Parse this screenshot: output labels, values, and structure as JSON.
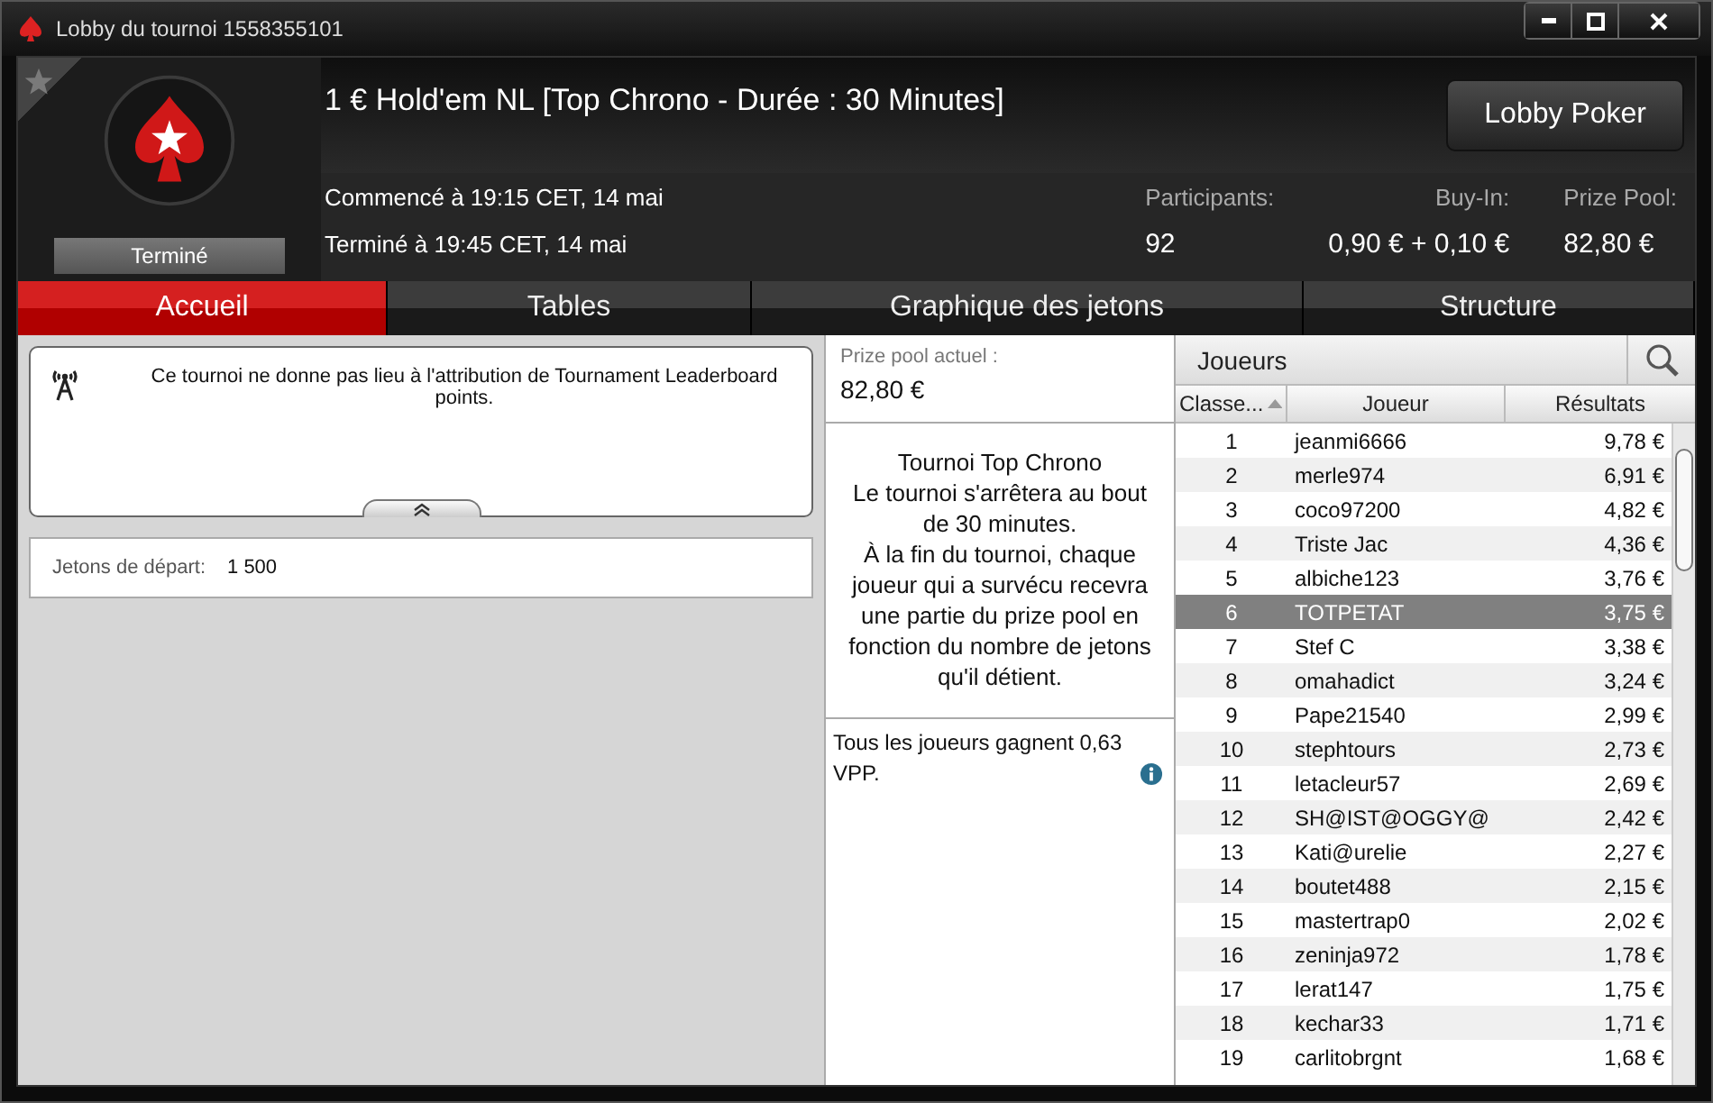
{
  "window": {
    "title": "Lobby du tournoi 1558355101"
  },
  "header": {
    "favorite": false,
    "status": "Terminé",
    "title": "1 € Hold'em NL [Top Chrono - Durée : 30 Minutes]",
    "started": "Commencé à 19:15 CET, 14 mai",
    "ended": "Terminé à 19:45 CET, 14 mai",
    "lobby_button": "Lobby Poker",
    "stats": [
      {
        "label": "Participants:",
        "value": "92"
      },
      {
        "label": "Buy-In:",
        "value": "0,90 € + 0,10 €"
      },
      {
        "label": "Prize Pool:",
        "value": "82,80 €"
      }
    ]
  },
  "tabs": [
    {
      "label": "Accueil",
      "selected": true
    },
    {
      "label": "Tables",
      "selected": false
    },
    {
      "label": "Graphique des jetons",
      "selected": false
    },
    {
      "label": "Structure",
      "selected": false
    }
  ],
  "notice": {
    "text": "Ce tournoi ne donne pas lieu à l'attribution de Tournament Leaderboard points."
  },
  "starting_chips": {
    "label": "Jetons de départ:",
    "value": "1 500"
  },
  "prize_pool": {
    "label": "Prize pool actuel :",
    "value": "82,80 €"
  },
  "description": [
    "Tournoi Top Chrono",
    "Le tournoi s'arrêtera au bout de 30 minutes.",
    "À la fin du tournoi, chaque joueur qui a survécu recevra une partie du prize pool en fonction du nombre de jetons qu'il détient."
  ],
  "vpp": {
    "text": "Tous les joueurs gagnent 0,63 VPP."
  },
  "players": {
    "title": "Joueurs",
    "columns": [
      {
        "label": "Classe...",
        "sorted": true
      },
      {
        "label": "Joueur",
        "sorted": false
      },
      {
        "label": "Résultats",
        "sorted": false
      }
    ],
    "rows": [
      {
        "rank": "1",
        "name": "jeanmi6666",
        "result": "9,78 €",
        "selected": false
      },
      {
        "rank": "2",
        "name": "merle974",
        "result": "6,91 €",
        "selected": false
      },
      {
        "rank": "3",
        "name": "coco97200",
        "result": "4,82 €",
        "selected": false
      },
      {
        "rank": "4",
        "name": "Triste Jac",
        "result": "4,36 €",
        "selected": false
      },
      {
        "rank": "5",
        "name": "albiche123",
        "result": "3,76 €",
        "selected": false
      },
      {
        "rank": "6",
        "name": "TOTPETAT",
        "result": "3,75 €",
        "selected": true
      },
      {
        "rank": "7",
        "name": "Stef C",
        "result": "3,38 €",
        "selected": false
      },
      {
        "rank": "8",
        "name": "omahadict",
        "result": "3,24 €",
        "selected": false
      },
      {
        "rank": "9",
        "name": "Pape21540",
        "result": "2,99 €",
        "selected": false
      },
      {
        "rank": "10",
        "name": "stephtours",
        "result": "2,73 €",
        "selected": false
      },
      {
        "rank": "11",
        "name": "letacleur57",
        "result": "2,69 €",
        "selected": false
      },
      {
        "rank": "12",
        "name": "SH@IST@OGGY@",
        "result": "2,42 €",
        "selected": false
      },
      {
        "rank": "13",
        "name": "Kati@urelie",
        "result": "2,27 €",
        "selected": false
      },
      {
        "rank": "14",
        "name": "boutet488",
        "result": "2,15 €",
        "selected": false
      },
      {
        "rank": "15",
        "name": "mastertrap0",
        "result": "2,02 €",
        "selected": false
      },
      {
        "rank": "16",
        "name": "zeninja972",
        "result": "1,78 €",
        "selected": false
      },
      {
        "rank": "17",
        "name": "lerat147",
        "result": "1,75 €",
        "selected": false
      },
      {
        "rank": "18",
        "name": "kechar33",
        "result": "1,71 €",
        "selected": false
      },
      {
        "rank": "19",
        "name": "carlitobrgnt",
        "result": "1,68 €",
        "selected": false
      }
    ]
  }
}
